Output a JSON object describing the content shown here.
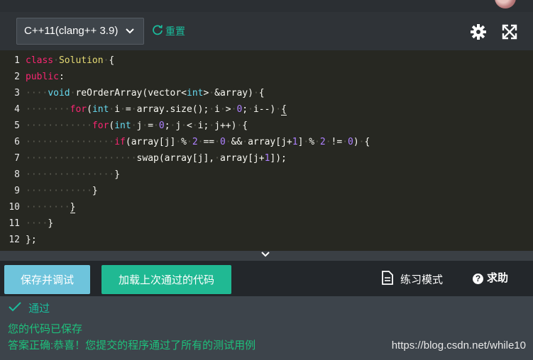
{
  "toolbar": {
    "language": "C++11(clang++ 3.9)",
    "reset_label": "重置"
  },
  "editor": {
    "line_numbers": [
      "1",
      "2",
      "3",
      "4",
      "5",
      "6",
      "7",
      "8",
      "9",
      "10",
      "11",
      "12"
    ]
  },
  "actions": {
    "save_debug": "保存并调试",
    "load_last": "加载上次通过的代码",
    "practice_mode": "练习模式",
    "help": "求助"
  },
  "result": {
    "status": "通过",
    "saved_msg": "您的代码已保存",
    "correct_msg": "答案正确:恭喜！您提交的程序通过了所有的测试用例"
  },
  "watermark": "https://blog.csdn.net/while10",
  "colors": {
    "accent": "#1abc9c",
    "debug_button": "#6ec4dc",
    "load_button": "#20b993",
    "editor_bg": "#272822"
  },
  "icons": [
    "chevron-down-icon",
    "refresh-icon",
    "gear-icon",
    "fullscreen-icon",
    "file-icon",
    "help-icon",
    "check-icon"
  ]
}
